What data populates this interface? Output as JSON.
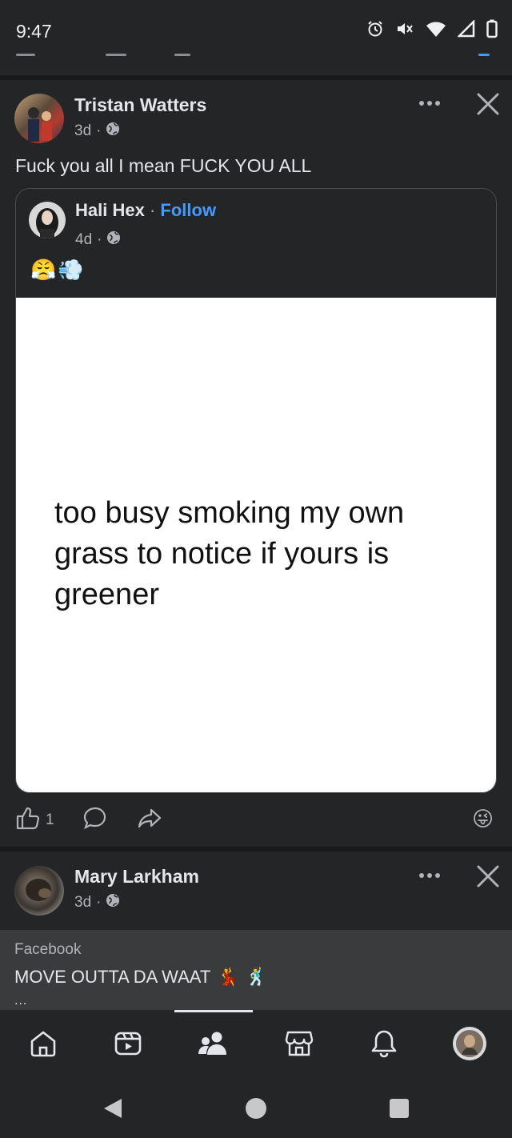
{
  "status_bar": {
    "time": "9:47",
    "icons": [
      "alarm-icon",
      "mute-icon",
      "wifi-icon",
      "signal-icon",
      "battery-icon"
    ]
  },
  "post1": {
    "author": "Tristan Watters",
    "time": "3d",
    "separator": "·",
    "privacy_icon": "globe-icon",
    "text": "Fuck you all I mean FUCK YOU ALL",
    "shared": {
      "author": "Hali Hex",
      "separator": "·",
      "follow_label": "Follow",
      "time": "4d",
      "emojis": [
        "😤",
        "💨"
      ],
      "image_text": "too busy smoking my own grass to notice if yours is greener"
    },
    "likes": "1",
    "reaction_emoji": "😜"
  },
  "post2": {
    "author": "Mary Larkham",
    "time": "3d",
    "separator": "·",
    "source": "Facebook",
    "text": "MOVE OUTTA DA WAAT",
    "emojis": [
      "💃",
      "🕺"
    ],
    "more": "..."
  },
  "bottom_nav": [
    "home-icon",
    "video-icon",
    "friends-icon",
    "marketplace-icon",
    "notifications-icon",
    "profile-avatar"
  ],
  "colors": {
    "background": "#242526",
    "divider": "#18191a",
    "accent": "#4599ff",
    "text": "#e4e6eb",
    "muted": "#b0b3b8"
  }
}
